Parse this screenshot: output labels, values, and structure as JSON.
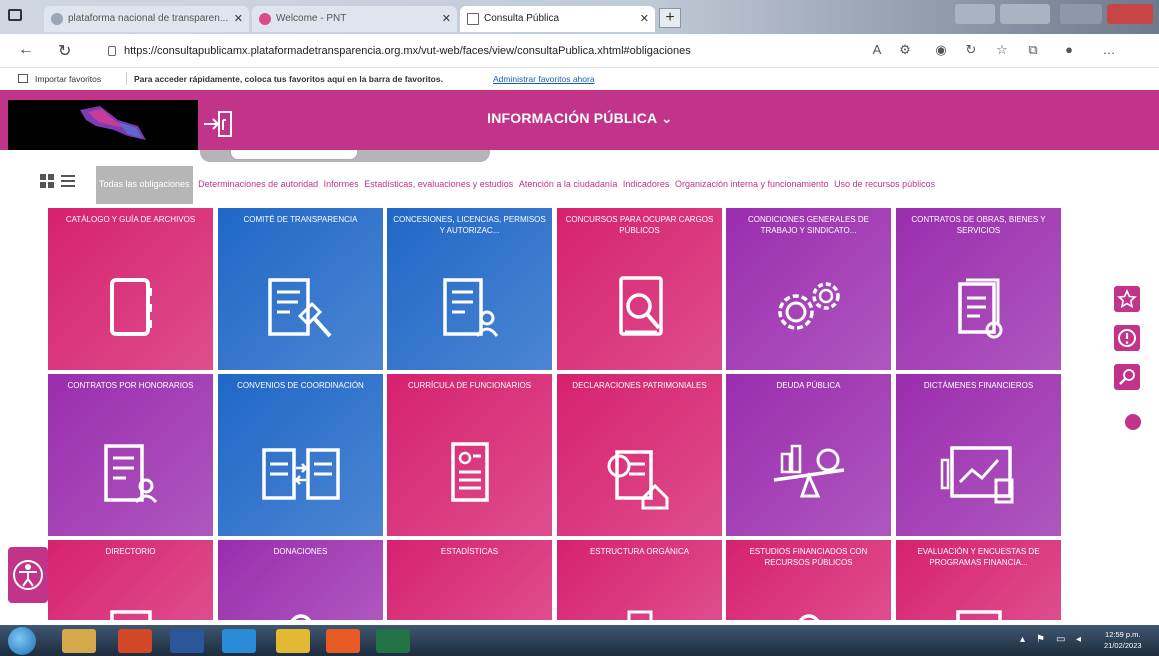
{
  "browser": {
    "tabs": [
      {
        "title": "plataforma nacional de transparen..."
      },
      {
        "title": "Welcome - PNT"
      },
      {
        "title": "Consulta Pública"
      }
    ],
    "url": "https://consultapublicamx.plataformadetransparencia.org.mx/vut-web/faces/view/consultaPublica.xhtml#obligaciones",
    "favorites": {
      "import_label": "Importar favoritos",
      "hint": "Para acceder rápidamente, coloca tus favoritos aquí en la barra de favoritos.",
      "manage_link": "Administrar favoritos ahora"
    }
  },
  "header": {
    "title": "INFORMACIÓN PÚBLICA ⌄",
    "brand_color": "#c2338a"
  },
  "filters": [
    "Todas las obligaciones",
    "Determinaciones de autoridad",
    "Informes",
    "Estadísticas, evaluaciones y estudios",
    "Atención a la ciudadanía",
    "Indicadores",
    "Organización interna y funcionamiento",
    "Uso de recursos públicos"
  ],
  "tiles": [
    {
      "label": "CATÁLOGO Y GUÍA DE ARCHIVOS",
      "color": "#d6216f",
      "icon": "binder-icon"
    },
    {
      "label": "COMITÉ DE TRANSPARENCIA",
      "color": "#1f67c7",
      "icon": "document-gavel-icon"
    },
    {
      "label": "CONCESIONES, LICENCIAS, PERMISOS Y AUTORIZAC...",
      "color": "#1f67c7",
      "icon": "document-user-icon"
    },
    {
      "label": "CONCURSOS PARA OCUPAR CARGOS PÚBLICOS",
      "color": "#d6216f",
      "icon": "document-search-icon"
    },
    {
      "label": "CONDICIONES GENERALES DE TRABAJO Y SINDICATO...",
      "color": "#9a2dae",
      "icon": "gears-icon"
    },
    {
      "label": "CONTRATOS DE OBRAS, BIENES Y SERVICIOS",
      "color": "#9a2dae",
      "icon": "documents-check-icon"
    },
    {
      "label": "CONTRATOS POR HONORARIOS",
      "color": "#9a2dae",
      "icon": "document-person-icon"
    },
    {
      "label": "CONVENIOS DE COORDINACIÓN",
      "color": "#1f67c7",
      "icon": "documents-exchange-icon"
    },
    {
      "label": "CURRÍCULA DE FUNCIONARIOS",
      "color": "#d6216f",
      "icon": "resume-icon"
    },
    {
      "label": "DECLARACIONES PATRIMONIALES",
      "color": "#d6216f",
      "icon": "document-house-icon"
    },
    {
      "label": "DEUDA PÚBLICA",
      "color": "#9a2dae",
      "icon": "scale-money-icon"
    },
    {
      "label": "DICTÁMENES FINANCIEROS",
      "color": "#9a2dae",
      "icon": "financial-chart-icon"
    },
    {
      "label": "DIRECTORIO",
      "color": "#d6216f",
      "icon": "directory-icon"
    },
    {
      "label": "DONACIONES",
      "color": "#9a2dae",
      "icon": "donation-icon"
    },
    {
      "label": "ESTADÍSTICAS",
      "color": "#d6216f",
      "icon": "statistics-icon"
    },
    {
      "label": "ESTRUCTURA ORGÁNICA",
      "color": "#d6216f",
      "icon": "org-structure-icon"
    },
    {
      "label": "ESTUDIOS FINANCIADOS CON RECURSOS PÚBLICOS",
      "color": "#d6216f",
      "icon": "study-icon"
    },
    {
      "label": "EVALUACIÓN Y ENCUESTAS DE PROGRAMAS FINANCIA...",
      "color": "#d6216f",
      "icon": "survey-icon"
    }
  ],
  "taskbar": {
    "clock_time": "12:59 p.m.",
    "clock_date": "21/02/2023"
  }
}
